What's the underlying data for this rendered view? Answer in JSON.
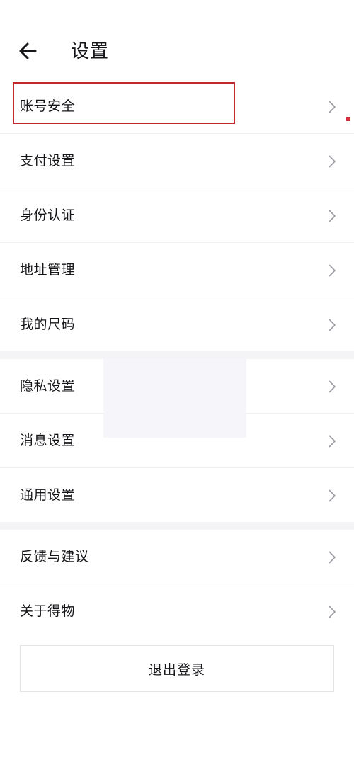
{
  "header": {
    "title": "设置"
  },
  "groups": [
    {
      "items": [
        {
          "label": "账号安全"
        },
        {
          "label": "支付设置"
        },
        {
          "label": "身份认证"
        },
        {
          "label": "地址管理"
        },
        {
          "label": "我的尺码"
        }
      ]
    },
    {
      "items": [
        {
          "label": "隐私设置"
        },
        {
          "label": "消息设置"
        },
        {
          "label": "通用设置"
        }
      ]
    },
    {
      "items": [
        {
          "label": "反馈与建议"
        },
        {
          "label": "关于得物"
        }
      ]
    }
  ],
  "footer": {
    "logout_label": "退出登录"
  },
  "icons": {
    "back": "arrow-left-icon",
    "row_chevron": "chevron-right-icon"
  },
  "colors": {
    "highlight_border": "#c4262e",
    "divider": "#f4f4f7",
    "text": "#16161a",
    "chevron": "#9a9aa3"
  }
}
